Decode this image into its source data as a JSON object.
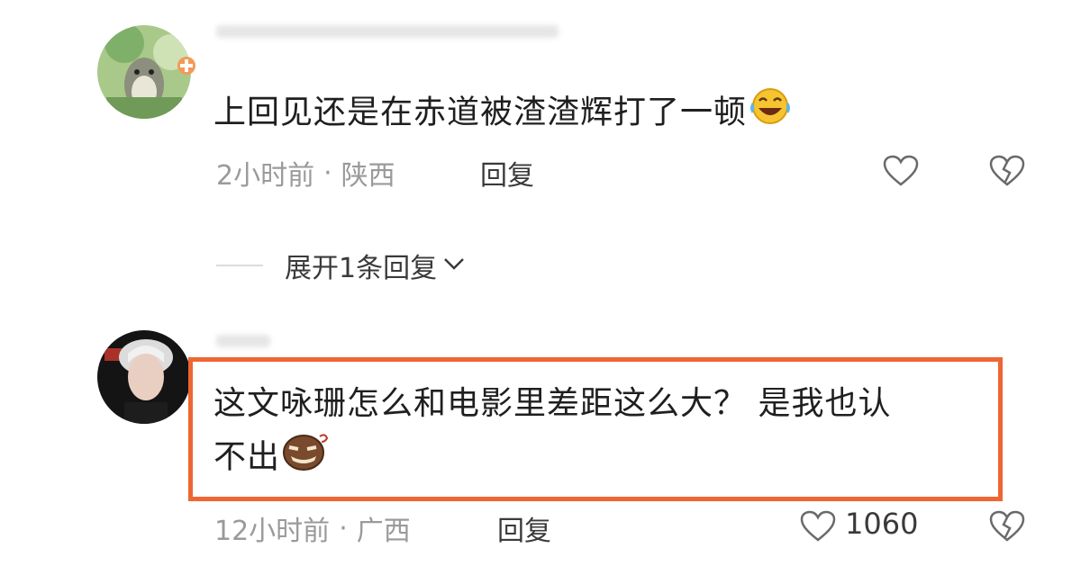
{
  "comments": [
    {
      "text": "上回见还是在赤道被渣渣辉打了一顿",
      "emoji": "laughing-tears-emoji",
      "time": "2小时前",
      "separator": "·",
      "location": "陕西",
      "reply_label": "回复",
      "expand_label": "展开1条回复"
    },
    {
      "text_line1": "这文咏珊怎么和电影里差距这么大？ 是我也认",
      "text_line2": "不出",
      "emoji": "smirk-emoji",
      "time": "12小时前",
      "separator": "·",
      "location": "广西",
      "reply_label": "回复",
      "like_count": "1060"
    }
  ],
  "icons": {
    "like": "heart-outline-icon",
    "dislike": "broken-heart-icon",
    "expand": "chevron-down-icon"
  },
  "colors": {
    "highlight_border": "#ee6633",
    "meta_text": "#9a9a9a",
    "body_text": "#1f1f1f"
  }
}
